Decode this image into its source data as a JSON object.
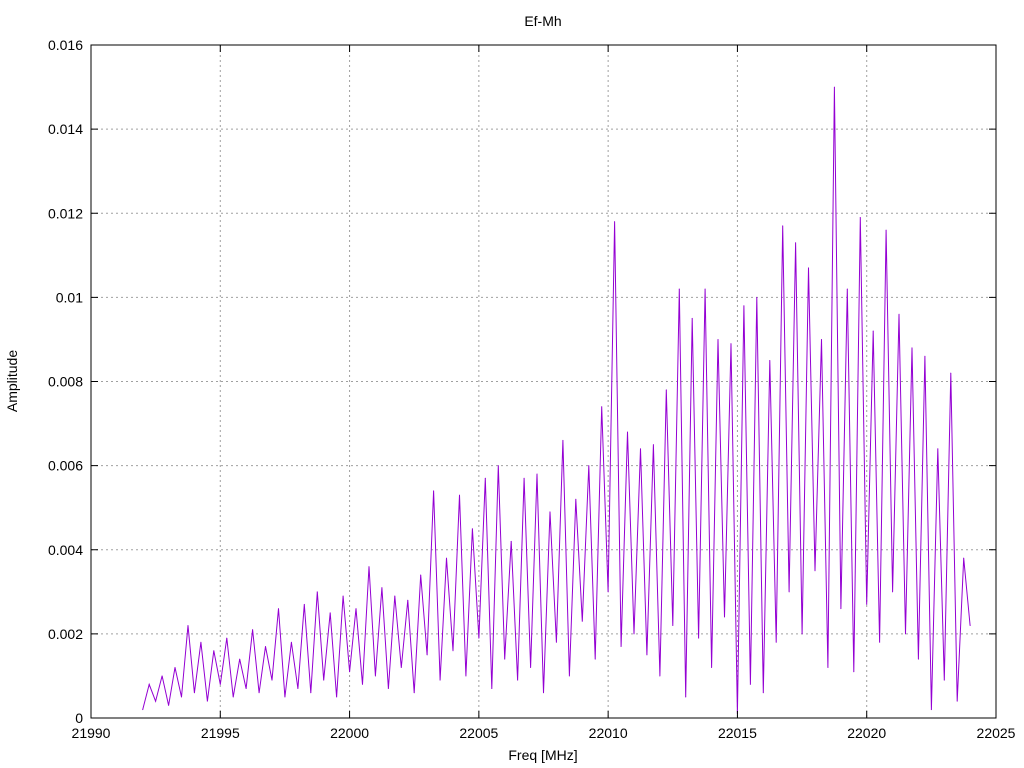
{
  "chart_data": {
    "type": "line",
    "title": "Ef-Mh",
    "xlabel": "Freq [MHz]",
    "ylabel": "Amplitude",
    "xlim": [
      21990,
      22025
    ],
    "ylim": [
      0,
      0.016
    ],
    "xticks": [
      21990,
      21995,
      22000,
      22005,
      22010,
      22015,
      22020,
      22025
    ],
    "xtick_labels": [
      "21990",
      "21995",
      "22000",
      "22005",
      "22010",
      "22015",
      "22020",
      "22025"
    ],
    "yticks": [
      0,
      0.002,
      0.004,
      0.006,
      0.008,
      0.01,
      0.012,
      0.014,
      0.016
    ],
    "ytick_labels": [
      "0",
      "0.002",
      "0.004",
      "0.006",
      "0.008",
      "0.01",
      "0.012",
      "0.014",
      "0.016"
    ],
    "grid": true,
    "legend": "none",
    "series": [
      {
        "name": "Ef-Mh",
        "color": "#9400d3",
        "x_start": 21992,
        "x_step": 0.25,
        "values": [
          0.0002,
          0.0008,
          0.0004,
          0.001,
          0.0003,
          0.0012,
          0.0005,
          0.0022,
          0.0006,
          0.0018,
          0.0004,
          0.0016,
          0.0008,
          0.0019,
          0.0005,
          0.0014,
          0.0007,
          0.0021,
          0.0006,
          0.0017,
          0.0009,
          0.0026,
          0.0005,
          0.0018,
          0.0007,
          0.0027,
          0.0006,
          0.003,
          0.0009,
          0.0025,
          0.0005,
          0.0029,
          0.0011,
          0.0026,
          0.0008,
          0.0036,
          0.001,
          0.0031,
          0.0007,
          0.0029,
          0.0012,
          0.0028,
          0.0006,
          0.0034,
          0.0015,
          0.0054,
          0.0009,
          0.0038,
          0.0016,
          0.0053,
          0.001,
          0.0045,
          0.0019,
          0.0057,
          0.0007,
          0.006,
          0.0014,
          0.0042,
          0.0009,
          0.0057,
          0.0012,
          0.0058,
          0.0006,
          0.0049,
          0.0018,
          0.0066,
          0.001,
          0.0052,
          0.0023,
          0.006,
          0.0014,
          0.0074,
          0.003,
          0.0118,
          0.0017,
          0.0068,
          0.002,
          0.0064,
          0.0015,
          0.0065,
          0.001,
          0.0078,
          0.0022,
          0.0102,
          0.0005,
          0.0095,
          0.0019,
          0.0102,
          0.0012,
          0.009,
          0.0024,
          0.0089,
          0.0001,
          0.0098,
          0.0008,
          0.01,
          0.0006,
          0.0085,
          0.0018,
          0.0117,
          0.003,
          0.0113,
          0.002,
          0.0107,
          0.0035,
          0.009,
          0.0012,
          0.015,
          0.0026,
          0.0102,
          0.0011,
          0.0119,
          0.0027,
          0.0092,
          0.0018,
          0.0116,
          0.003,
          0.0096,
          0.002,
          0.0088,
          0.0014,
          0.0086,
          0.0002,
          0.0064,
          0.0009,
          0.0082,
          0.0004,
          0.0038,
          0.0022
        ]
      }
    ]
  }
}
